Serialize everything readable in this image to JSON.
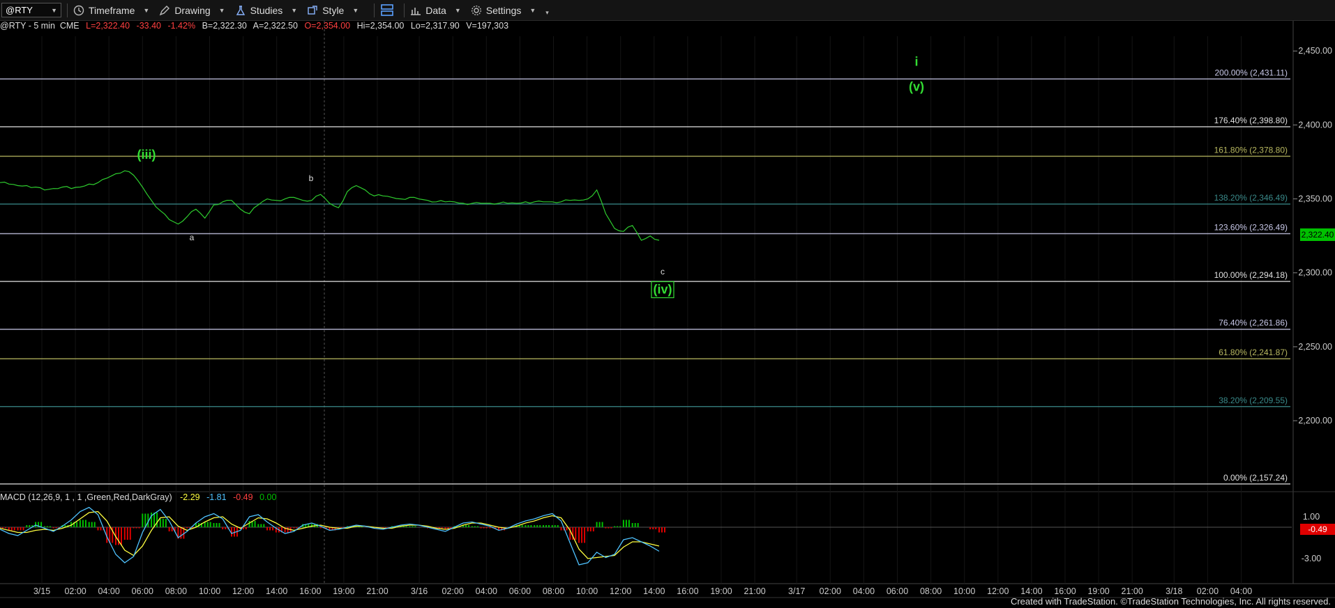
{
  "toolbar": {
    "symbol": "@RTY",
    "items": [
      {
        "label": "Timeframe",
        "icon": "clock-icon"
      },
      {
        "label": "Drawing",
        "icon": "pencil-icon"
      },
      {
        "label": "Studies",
        "icon": "flask-icon"
      },
      {
        "label": "Style",
        "icon": "style-icon"
      },
      {
        "label": "Data",
        "icon": "bar-chart-icon"
      },
      {
        "label": "Settings",
        "icon": "gear-icon"
      }
    ]
  },
  "infobar": {
    "symbol": "@RTY - 5 min  CME",
    "last": "L=2,322.40",
    "change": "-33.40",
    "pct": "-1.42%",
    "bid": "B=2,322.30",
    "ask": "A=2,322.50",
    "open": "O=2,354.00",
    "high": "Hi=2,354.00",
    "low": "Lo=2,317.90",
    "volume": "V=197,303"
  },
  "colors": {
    "price_line": "#2ecc2e",
    "wave_label": "#33dd33",
    "up": "#00c000",
    "down": "#e00000",
    "macd_line": "#4fc3ff",
    "signal_line": "#ffff40"
  },
  "chart_data": [
    {
      "type": "line",
      "title": "@RTY - 5 min CME",
      "y_ticks": [
        "2,450.00",
        "2,400.00",
        "2,350.00",
        "2,300.00",
        "2,250.00",
        "2,200.00"
      ],
      "y_tick_values": [
        2450,
        2400,
        2350,
        2300,
        2250,
        2200
      ],
      "ylim": [
        2152,
        2460
      ],
      "x_labels": [
        "3/15",
        "02:00",
        "04:00",
        "06:00",
        "08:00",
        "10:00",
        "12:00",
        "14:00",
        "16:00",
        "19:00",
        "21:00",
        "3/16",
        "02:00",
        "04:00",
        "06:00",
        "08:00",
        "10:00",
        "12:00",
        "14:00",
        "16:00",
        "19:00",
        "21:00",
        "3/17",
        "02:00",
        "04:00",
        "06:00",
        "08:00",
        "10:00",
        "12:00",
        "14:00",
        "16:00",
        "19:00",
        "21:00",
        "3/18",
        "02:00",
        "04:00"
      ],
      "fib_levels": [
        {
          "label": "200.00% (2,431.11)",
          "value": 2431.11,
          "color": "#c8c8e8"
        },
        {
          "label": "176.40% (2,398.80)",
          "value": 2398.8,
          "color": "#e0e0e0"
        },
        {
          "label": "161.80% (2,378.80)",
          "value": 2378.8,
          "color": "#b8b860"
        },
        {
          "label": "138.20% (2,346.49)",
          "value": 2346.49,
          "color": "#3a8a8a"
        },
        {
          "label": "123.60% (2,326.49)",
          "value": 2326.49,
          "color": "#c8c8e8"
        },
        {
          "label": "100.00% (2,294.18)",
          "value": 2294.18,
          "color": "#e0e0e0"
        },
        {
          "label": "76.40% (2,261.86)",
          "value": 2261.86,
          "color": "#c8c8e8"
        },
        {
          "label": "61.80% (2,241.87)",
          "value": 2241.87,
          "color": "#b8b860"
        },
        {
          "label": "38.20% (2,209.55)",
          "value": 2209.55,
          "color": "#3a8a8a"
        },
        {
          "label": "0.00% (2,157.24)",
          "value": 2157.24,
          "color": "#e0e0e0"
        }
      ],
      "last_price": "2,322.40",
      "series": [
        {
          "x": [
            0,
            1,
            2,
            3,
            4,
            5,
            6,
            7,
            8,
            9,
            10,
            11,
            12,
            13,
            14,
            15,
            16,
            17,
            18,
            19,
            20,
            21,
            22,
            23,
            24,
            25,
            26,
            27,
            28,
            29,
            30,
            31,
            32,
            33,
            34,
            35,
            36,
            37,
            38,
            39,
            40,
            41,
            42,
            43,
            44,
            45,
            46,
            47,
            48,
            49,
            50,
            51,
            52,
            53,
            54,
            55,
            56,
            57,
            58,
            59,
            60,
            61,
            62,
            63,
            64,
            65,
            66,
            67,
            68,
            69,
            70,
            71,
            72,
            73,
            74
          ],
          "values": [
            2361,
            2360,
            2359,
            2359,
            2358,
            2356,
            2357,
            2358,
            2357,
            2358,
            2360,
            2361,
            2364,
            2367,
            2369,
            2366,
            2358,
            2349,
            2342,
            2336,
            2333,
            2338,
            2343,
            2337,
            2346,
            2348,
            2349,
            2343,
            2340,
            2346,
            2350,
            2349,
            2350,
            2351,
            2349,
            2349,
            2353,
            2347,
            2344,
            2355,
            2359,
            2356,
            2352,
            2352,
            2351,
            2350,
            2351,
            2350,
            2349,
            2348,
            2348,
            2348,
            2347,
            2347,
            2347,
            2347,
            2347,
            2347,
            2347,
            2348,
            2348,
            2348,
            2348,
            2348,
            2349,
            2349,
            2350,
            2356,
            2340,
            2330,
            2328,
            2332,
            2322,
            2325,
            2322
          ]
        }
      ],
      "annotations": [
        {
          "text": "(iii)",
          "value": 2377,
          "color": "#33dd33"
        },
        {
          "text": "a",
          "value": 2322,
          "color": "#dddddd"
        },
        {
          "text": "b",
          "value": 2362,
          "color": "#dddddd"
        },
        {
          "text": "c",
          "value": 2299,
          "color": "#dddddd"
        },
        {
          "text": "(iv)",
          "value": 2286,
          "color": "#33dd33",
          "boxed": true
        },
        {
          "text": "i",
          "value": 2440,
          "color": "#33dd33"
        },
        {
          "text": "(v)",
          "value": 2423,
          "color": "#33dd33"
        }
      ]
    },
    {
      "type": "bar",
      "title": "MACD (12,26,9, 1 , 1 ,Green,Red,DarkGray)",
      "values_text": [
        "-2.29",
        "-1.81",
        "-0.49",
        "0.00"
      ],
      "y_ticks": [
        "1.00",
        "-3.00"
      ],
      "y_tick_values": [
        1,
        -3
      ],
      "ylim": [
        -4.2,
        2.2
      ],
      "last_value": "-0.49",
      "series": [
        {
          "name": "MACD",
          "values": [
            -0.2,
            -0.6,
            -0.8,
            -0.3,
            0.2,
            -0.1,
            -0.4,
            0.1,
            0.7,
            1.5,
            1.9,
            1.2,
            -0.9,
            -2.6,
            -3.4,
            -2.8,
            -0.5,
            1.1,
            1.7,
            0.6,
            -1.0,
            -0.4,
            0.4,
            1.0,
            1.3,
            0.8,
            -0.6,
            -0.3,
            1.0,
            1.2,
            0.5,
            -0.1,
            -0.6,
            -0.4,
            0.2,
            0.4,
            0.1,
            -0.3,
            -0.2,
            0.0,
            0.2,
            0.1,
            -0.1,
            -0.2,
            0.0,
            0.2,
            0.3,
            0.2,
            0.0,
            -0.2,
            -0.4,
            0.0,
            0.4,
            0.5,
            0.3,
            0.1,
            -0.3,
            -0.1,
            0.3,
            0.6,
            0.8,
            1.1,
            1.3,
            0.6,
            -1.5,
            -3.6,
            -3.4,
            -2.4,
            -2.9,
            -2.6,
            -1.2,
            -1.0,
            -1.4,
            -1.8,
            -2.3
          ]
        },
        {
          "name": "Signal",
          "values": [
            -0.1,
            -0.3,
            -0.5,
            -0.5,
            -0.3,
            -0.2,
            -0.3,
            -0.1,
            0.2,
            0.8,
            1.4,
            1.5,
            0.6,
            -0.9,
            -2.2,
            -2.7,
            -1.8,
            -0.3,
            0.9,
            1.0,
            0.1,
            -0.3,
            0.0,
            0.5,
            0.9,
            1.0,
            0.3,
            -0.1,
            0.4,
            0.9,
            0.8,
            0.4,
            -0.1,
            -0.3,
            -0.1,
            0.1,
            0.2,
            0.0,
            -0.1,
            -0.1,
            0.1,
            0.1,
            0.0,
            -0.1,
            -0.1,
            0.1,
            0.2,
            0.2,
            0.1,
            -0.1,
            -0.2,
            -0.1,
            0.2,
            0.4,
            0.4,
            0.2,
            0.0,
            -0.1,
            0.1,
            0.4,
            0.6,
            0.9,
            1.1,
            0.9,
            -0.3,
            -2.1,
            -3.0,
            -2.9,
            -2.8,
            -2.7,
            -1.9,
            -1.4,
            -1.4,
            -1.6,
            -1.8
          ]
        },
        {
          "name": "Histogram",
          "values": [
            -0.1,
            -0.3,
            -0.3,
            0.2,
            0.5,
            0.1,
            -0.1,
            0.2,
            0.5,
            0.7,
            0.5,
            -0.3,
            -1.5,
            -1.7,
            -1.2,
            -0.1,
            1.3,
            1.4,
            0.8,
            -0.4,
            -1.1,
            -0.1,
            0.4,
            0.5,
            0.4,
            -0.2,
            -0.9,
            -0.2,
            0.6,
            0.3,
            -0.3,
            -0.5,
            -0.5,
            -0.1,
            0.3,
            0.3,
            -0.1,
            -0.3,
            -0.1,
            0.1,
            0.1,
            0.0,
            -0.1,
            -0.1,
            0.1,
            0.1,
            0.1,
            0.0,
            -0.1,
            -0.1,
            -0.2,
            0.1,
            0.2,
            0.1,
            -0.1,
            -0.1,
            -0.3,
            0.0,
            0.2,
            0.2,
            0.2,
            0.2,
            0.2,
            -0.3,
            -1.2,
            -1.5,
            -0.4,
            0.5,
            -0.1,
            0.1,
            0.7,
            0.4,
            0.0,
            -0.2,
            -0.5
          ]
        }
      ]
    }
  ],
  "credit": "Created with TradeStation. ©TradeStation Technologies, Inc. All rights reserved."
}
